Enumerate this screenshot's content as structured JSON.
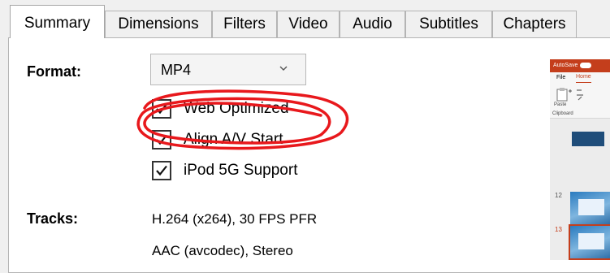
{
  "tabs": [
    {
      "label": "Summary",
      "active": true
    },
    {
      "label": "Dimensions",
      "active": false
    },
    {
      "label": "Filters",
      "active": false
    },
    {
      "label": "Video",
      "active": false
    },
    {
      "label": "Audio",
      "active": false
    },
    {
      "label": "Subtitles",
      "active": false
    },
    {
      "label": "Chapters",
      "active": false
    }
  ],
  "summary": {
    "format_label": "Format:",
    "format_value": "MP4",
    "options": [
      {
        "label": "Web Optimized",
        "checked": true
      },
      {
        "label": "Align A/V Start",
        "checked": true
      },
      {
        "label": "iPod 5G Support",
        "checked": true
      }
    ],
    "tracks_label": "Tracks:",
    "tracks": [
      "H.264 (x264), 30 FPS PFR",
      "AAC (avcodec), Stereo"
    ]
  },
  "annotation": {
    "color": "#e8181c",
    "target": "Web Optimized"
  },
  "ppt_thumbnail": {
    "autosave_label": "AutoSave",
    "menu": [
      "File",
      "Home"
    ],
    "ribbon": {
      "paste_label": "Paste",
      "clipboard_label": "Clipboard"
    },
    "slide_numbers": [
      "12",
      "13"
    ],
    "accent": "#c43e1c"
  }
}
